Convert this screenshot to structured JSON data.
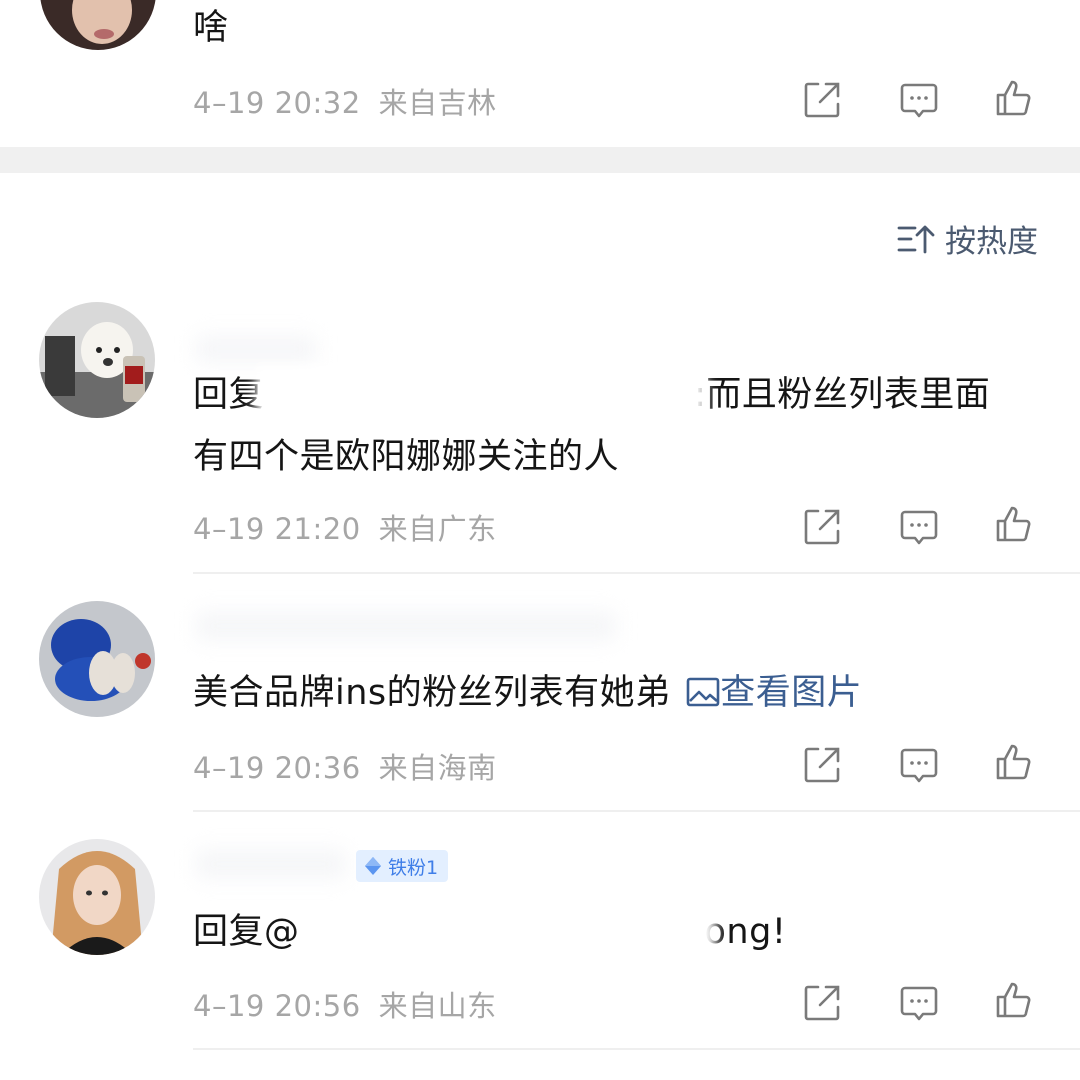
{
  "comments": [
    {
      "text": "啥",
      "time": "4–19 20:32",
      "location": "来自吉林"
    },
    {
      "text_prefix": "回复",
      "text_suffix": ":而且粉丝列表里面",
      "text_line2": "有四个是欧阳娜娜关注的人",
      "time": "4–19 21:20",
      "location": "来自广东"
    },
    {
      "text": "美合品牌ins的粉丝列表有她弟",
      "link_label": "查看图片",
      "time": "4–19 20:36",
      "location": "来自海南"
    },
    {
      "text_prefix": "回复@",
      "text_suffix": "ong!",
      "badge": "铁粉1",
      "time": "4–19 20:56",
      "location": "来自山东"
    }
  ],
  "sort": {
    "label": "按热度"
  },
  "icons": {
    "share": "share-icon",
    "comment": "comment-icon",
    "like": "like-icon",
    "sort": "sort-icon",
    "image": "image-icon",
    "fan_badge": "diamond-icon"
  },
  "colors": {
    "link": "#3b5e91",
    "meta": "#a6a6a6",
    "badge_bg": "#e3efff",
    "badge_text": "#3f7ee8",
    "section_gap": "#f0f0f0"
  }
}
